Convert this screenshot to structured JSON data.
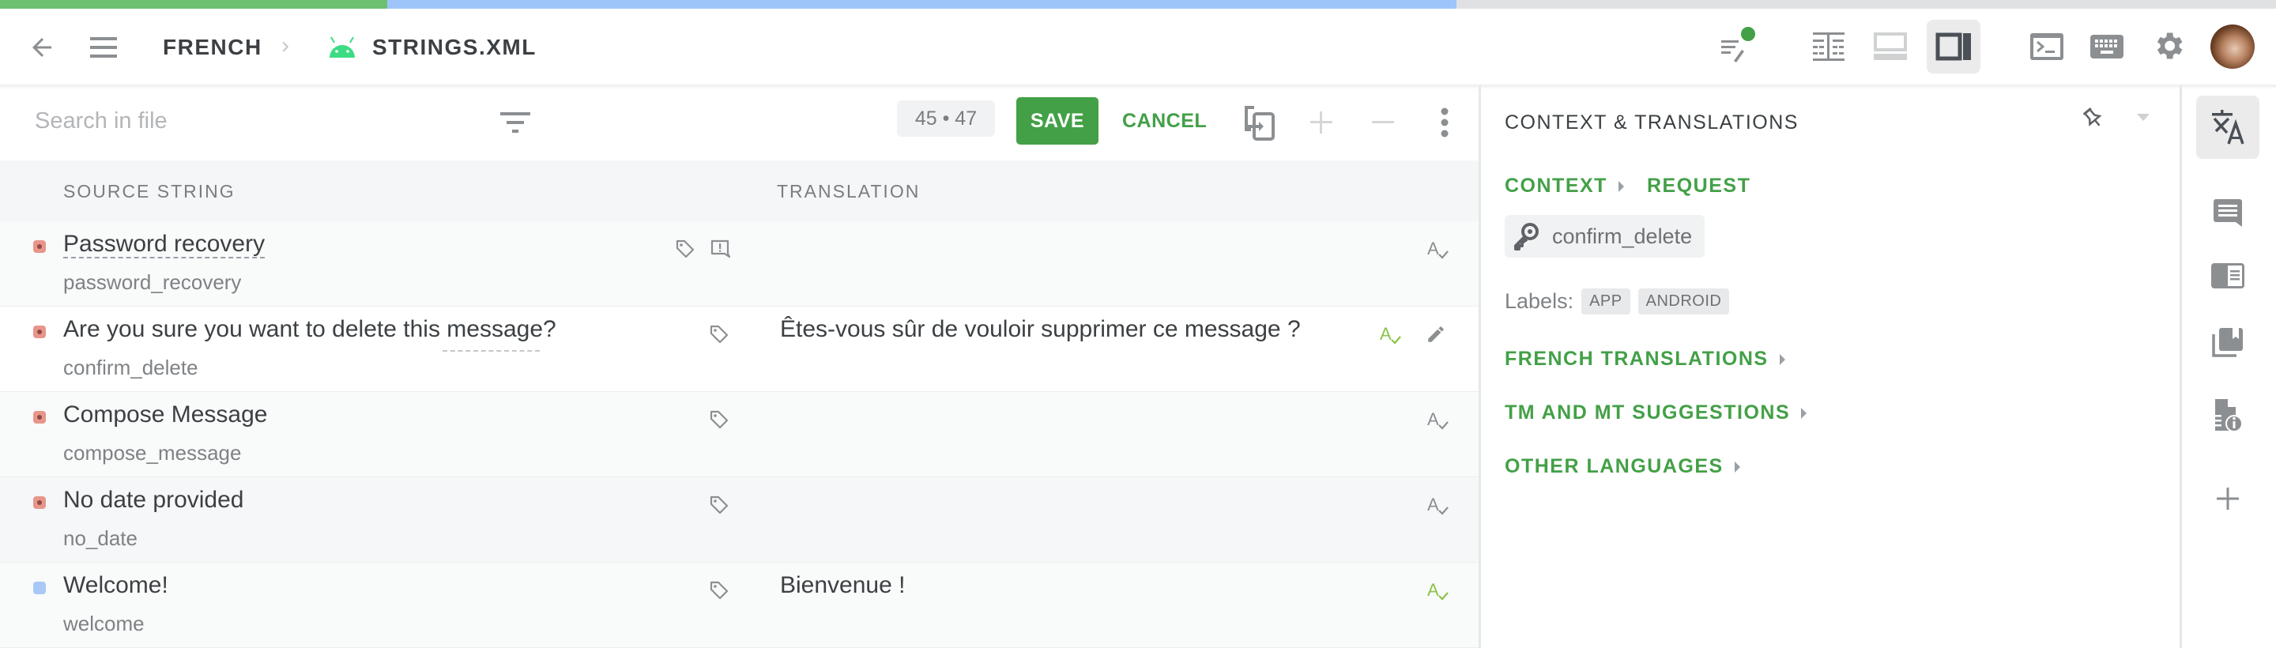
{
  "progress": {
    "translated_fraction": 0.17,
    "in_progress_fraction": 0.47,
    "translated_color": "#6cc070",
    "in_progress_color": "#9ec5fa",
    "remaining_color": "#e0e1e3"
  },
  "header": {
    "breadcrumb": [
      "FRENCH",
      "STRINGS.XML"
    ],
    "file_icon": "android-icon",
    "icons": [
      "back-arrow-icon",
      "menu-icon",
      "review-mode-icon",
      "side-by-side-layout-icon",
      "bottom-panel-layout-icon",
      "right-panel-layout-icon",
      "terminal-icon",
      "keyboard-icon",
      "settings-icon",
      "user-avatar"
    ],
    "active_layout": "right-panel-layout",
    "notification_dot_color": "#43a047"
  },
  "toolbar": {
    "search_placeholder": "Search in file",
    "search_value": "",
    "counter": "45 • 47",
    "save_label": "SAVE",
    "cancel_label": "CANCEL"
  },
  "table": {
    "columns": [
      "SOURCE STRING",
      "TRANSLATION"
    ],
    "rows": [
      {
        "status": "untranslated",
        "source": "Password recovery",
        "key": "password_recovery",
        "translation": "",
        "has_tag": true,
        "has_issue": true,
        "spell_status": "none"
      },
      {
        "status": "untranslated",
        "source": "Are you sure you want to delete this message?",
        "key": "confirm_delete",
        "translation": "Êtes-vous sûr de vouloir supprimer ce message ?",
        "has_tag": true,
        "has_issue": false,
        "spell_status": "ok",
        "selected": true
      },
      {
        "status": "untranslated",
        "source": "Compose Message",
        "key": "compose_message",
        "translation": "",
        "has_tag": true,
        "has_issue": false,
        "spell_status": "none"
      },
      {
        "status": "untranslated",
        "source": "No date provided",
        "key": "no_date",
        "translation": "",
        "has_tag": true,
        "has_issue": false,
        "spell_status": "none"
      },
      {
        "status": "translated",
        "source": "Welcome!",
        "key": "welcome",
        "translation": "Bienvenue !",
        "has_tag": true,
        "has_issue": false,
        "spell_status": "ok"
      }
    ]
  },
  "panel": {
    "title": "CONTEXT & TRANSLATIONS",
    "context_label": "CONTEXT",
    "request_label": "REQUEST",
    "string_key": "confirm_delete",
    "labels_label": "Labels:",
    "labels": [
      "APP",
      "ANDROID"
    ],
    "sections": [
      "FRENCH TRANSLATIONS",
      "TM AND MT SUGGESTIONS",
      "OTHER LANGUAGES"
    ]
  },
  "rail": {
    "items": [
      "translate-icon",
      "comments-icon",
      "glossary-icon",
      "tm-library-icon",
      "file-info-icon",
      "add-icon"
    ],
    "active": "translate-icon"
  },
  "colors": {
    "accent_green": "#43a047",
    "spell_ok_green": "#8bc34a",
    "untranslated_red": "#e8958a",
    "translated_blue": "#a8c9f8"
  }
}
